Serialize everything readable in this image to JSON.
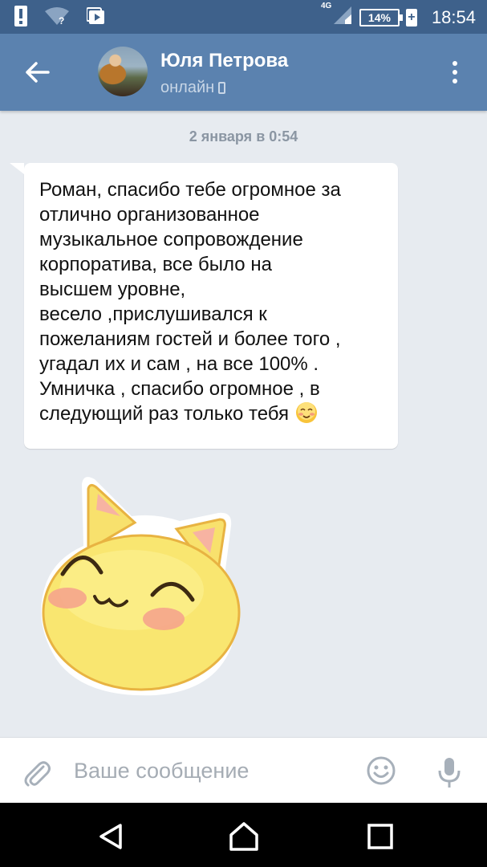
{
  "status_bar": {
    "network": "4G",
    "battery": "14%",
    "battery_plus": "+",
    "time": "18:54"
  },
  "header": {
    "contact_name": "Юля Петрова",
    "contact_status": "онлайн"
  },
  "chat": {
    "date_separator": "2 января в 0:54",
    "message_text": "Роман, спасибо тебе огромное за\nотлично организованное\nмузыкальное сопровождение\nкорпоратива, все было на\nвысшем уровне,\nвесело ,прислушивался к\nпожеланиям гостей и более того ,\nугадал их и сам , на все 100% .\nУмничка , спасибо огромное , в\nследующий раз только тебя"
  },
  "input_bar": {
    "placeholder": "Ваше сообщение"
  },
  "icons": {
    "sticker": "smiling-cat-sticker",
    "attach": "paperclip-icon",
    "emoji": "smiley-icon",
    "mic": "microphone-icon"
  },
  "colors": {
    "status_bar": "#3e618b",
    "header": "#5b82af",
    "chat_background": "#e7ebf0",
    "bubble": "#ffffff"
  }
}
